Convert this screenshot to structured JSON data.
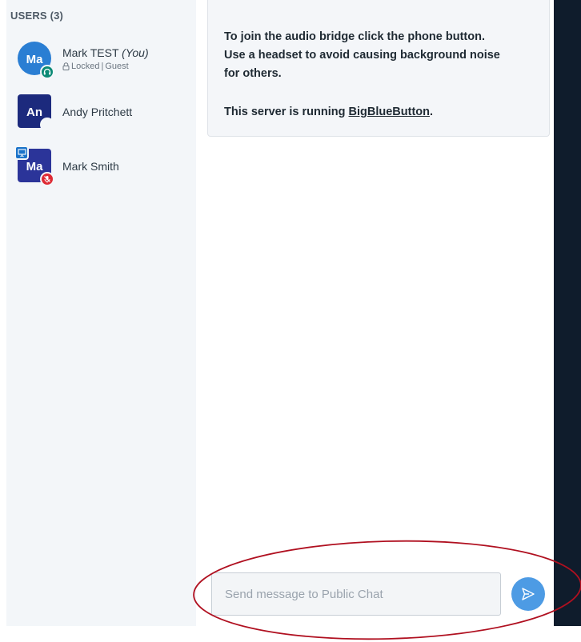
{
  "users_panel": {
    "header": "USERS (3)",
    "users": [
      {
        "initials": "Ma",
        "name": "Mark TEST",
        "you_label": "(You)",
        "status": "Locked",
        "role": "Guest",
        "avatar_color": "#2a7ed3",
        "avatar_shape": "circle",
        "badge": "headset-icon",
        "badge_color": "#0b8a76"
      },
      {
        "initials": "An",
        "name": "Andy Pritchett",
        "avatar_color": "#1c2a7d",
        "avatar_shape": "square"
      },
      {
        "initials": "Ma",
        "name": "Mark Smith",
        "avatar_color": "#2b3499",
        "avatar_shape": "square",
        "presenter_badge": "presentation-icon",
        "badge": "muted-microphone-icon",
        "badge_color": "#de2a33"
      }
    ]
  },
  "welcome_message": {
    "line1": "To join the audio bridge click the phone button.",
    "line2": "Use a headset to avoid causing background noise",
    "line3": "for others.",
    "line4_prefix": "This server is running ",
    "line4_link": "BigBlueButton",
    "line4_suffix": "."
  },
  "chat_input": {
    "placeholder": "Send message to Public Chat",
    "value": ""
  },
  "send_button": {
    "icon": "send-arrow-icon",
    "color": "#4d9be4"
  },
  "colors": {
    "sidebar_bg": "#f3f6f9",
    "dark_strip": "#0f1c2c",
    "annotation": "#b01020"
  }
}
